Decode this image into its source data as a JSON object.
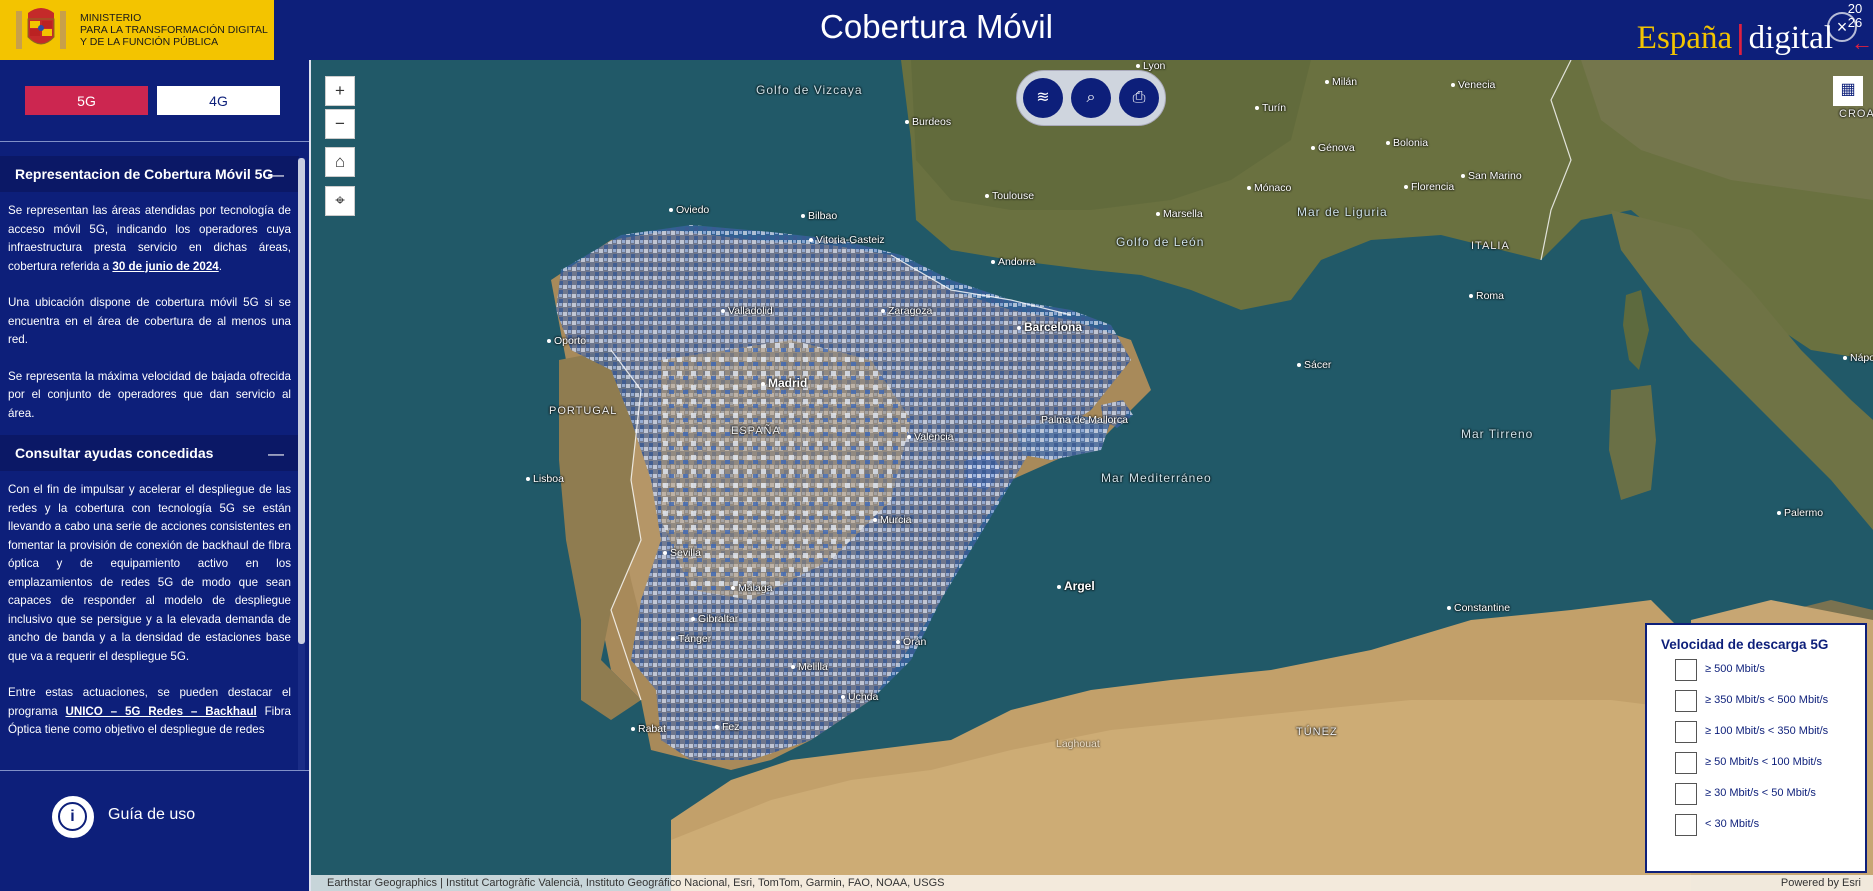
{
  "header": {
    "ministry_line1": "Ministerio",
    "ministry_line2": "para la transformación digital",
    "ministry_line3": "y de la función pública",
    "title": "Cobertura Móvil",
    "brand_part1": "España",
    "brand_sep": "|",
    "brand_part2": "digital",
    "year_top": "20",
    "year_bottom": "26"
  },
  "tabs": [
    {
      "label": "5G",
      "active": true
    },
    {
      "label": "4G",
      "active": false
    }
  ],
  "sections": [
    {
      "title": "Representacion de Cobertura Móvil 5G",
      "toggle": "—",
      "p1_a": "Se representan las áreas atendidas por tecnología de acceso móvil 5G, indicando los operadores cuya infraestructura presta servicio en dichas áreas, cobertura referida a ",
      "p1_date": "30 de junio de 2024",
      "p1_b": ".",
      "p2": "Una ubicación dispone de cobertura móvil 5G si se encuentra en el área de cobertura de al menos una red.",
      "p3": "Se representa la máxima velocidad de bajada ofrecida por el conjunto de operadores que dan servicio al área."
    },
    {
      "title": "Consultar ayudas concedidas",
      "toggle": "—",
      "p1": "Con el fin de impulsar y acelerar el despliegue de las redes y la cobertura con tecnología 5G se están llevando a cabo una serie de acciones consistentes en fomentar la provisión de conexión de backhaul de fibra óptica y de equipamiento activo en los emplazamientos de redes 5G de modo que sean capaces de responder al modelo de despliegue inclusivo que se persigue y a la elevada demanda de ancho de banda y a la densidad de estaciones base que va a requerir el despliegue 5G.",
      "p2_a": "Entre estas actuaciones, se pueden destacar el programa ",
      "p2_link": "UNICO – 5G Redes – Backhaul",
      "p2_b": " Fibra Óptica tiene como objetivo el despliegue de redes"
    }
  ],
  "guide_label": "Guía de uso",
  "map": {
    "zoom_in": "+",
    "zoom_out": "−",
    "labels": [
      {
        "t": "Golfo de Vizcaya",
        "kind": "sea"
      },
      {
        "t": "Golfo de León",
        "kind": "sea"
      },
      {
        "t": "Mar de Liguria",
        "kind": "sea"
      },
      {
        "t": "Mar Tirreno",
        "kind": "sea"
      },
      {
        "t": "Mar Mediterráneo",
        "kind": "sea"
      },
      {
        "t": "PORTUGAL",
        "kind": "country"
      },
      {
        "t": "ESPAÑA",
        "kind": "country"
      },
      {
        "t": "ITALIA",
        "kind": "country"
      },
      {
        "t": "CROA",
        "kind": "country"
      },
      {
        "t": "TÚNEZ",
        "kind": "country"
      },
      {
        "t": "Lyon"
      },
      {
        "t": "Milán"
      },
      {
        "t": "Venecia"
      },
      {
        "t": "Turín"
      },
      {
        "t": "Burdeos"
      },
      {
        "t": "Génova"
      },
      {
        "t": "Bolonia"
      },
      {
        "t": "Mónaco"
      },
      {
        "t": "Florencia"
      },
      {
        "t": "San Marino"
      },
      {
        "t": "Toulouse"
      },
      {
        "t": "Marsella"
      },
      {
        "t": "Oviedo"
      },
      {
        "t": "Bilbao"
      },
      {
        "t": "Vitoria-Gasteiz"
      },
      {
        "t": "Andorra"
      },
      {
        "t": "Roma"
      },
      {
        "t": "Valladolid"
      },
      {
        "t": "Zaragoza"
      },
      {
        "t": "Barcelona"
      },
      {
        "t": "Oporto"
      },
      {
        "t": "Nápo"
      },
      {
        "t": "Sácer"
      },
      {
        "t": "Madrid"
      },
      {
        "t": "Palma de Mallorca"
      },
      {
        "t": "Valencia"
      },
      {
        "t": "Lisboa"
      },
      {
        "t": "Murcia"
      },
      {
        "t": "Palermo"
      },
      {
        "t": "Sevilla"
      },
      {
        "t": "Argel"
      },
      {
        "t": "Málaga"
      },
      {
        "t": "Constantine"
      },
      {
        "t": "Gibraltar"
      },
      {
        "t": "Tánger"
      },
      {
        "t": "Orán"
      },
      {
        "t": "Melilla"
      },
      {
        "t": "Uchda"
      },
      {
        "t": "Rabat"
      },
      {
        "t": "Fez"
      },
      {
        "t": "Laghouat"
      }
    ]
  },
  "legend": {
    "title": "Velocidad de descarga 5G",
    "items": [
      {
        "label": "≥ 500 Mbit/s",
        "color": "#3b5a92"
      },
      {
        "label": "≥ 350 Mbit/s < 500 Mbit/s",
        "color": "#3f68b5"
      },
      {
        "label": "≥ 100 Mbit/s < 350 Mbit/s",
        "color": "#4a7fd0"
      },
      {
        "label": "≥ 50 Mbit/s < 100 Mbit/s",
        "color": "#6d9be0"
      },
      {
        "label": "≥ 30 Mbit/s < 50 Mbit/s",
        "color": "#a6c0ec"
      },
      {
        "label": "< 30 Mbit/s",
        "color": "#e4e8f2"
      }
    ]
  },
  "attribution": "Earthstar Geographics | Institut Cartogràfic Valencià, Instituto Geográfico Nacional, Esri, TomTom, Garmin, FAO, NOAA, USGS",
  "powered_by": "Powered by Esri",
  "colors": {
    "brand_blue": "#0d1f7a",
    "accent_red": "#cc2650",
    "brand_yellow": "#f3c400"
  }
}
